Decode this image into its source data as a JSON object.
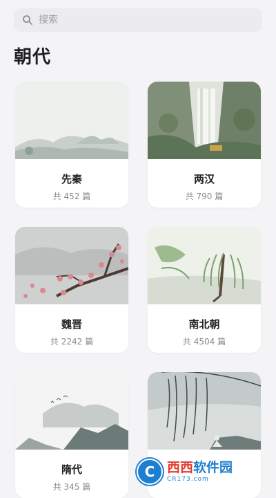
{
  "search": {
    "placeholder": "搜索"
  },
  "section_title": "朝代",
  "dynasties": [
    {
      "name": "先秦",
      "count": "共 452 篇"
    },
    {
      "name": "两汉",
      "count": "共 790 篇"
    },
    {
      "name": "魏晋",
      "count": "共 2242 篇"
    },
    {
      "name": "南北朝",
      "count": "共 4504 篇"
    },
    {
      "name": "隋代",
      "count": "共 345 篇"
    },
    {
      "name": "",
      "count": ""
    }
  ],
  "watermark": {
    "brand_part1": "西西",
    "brand_part2": "软件园",
    "url": "CR173.com"
  }
}
